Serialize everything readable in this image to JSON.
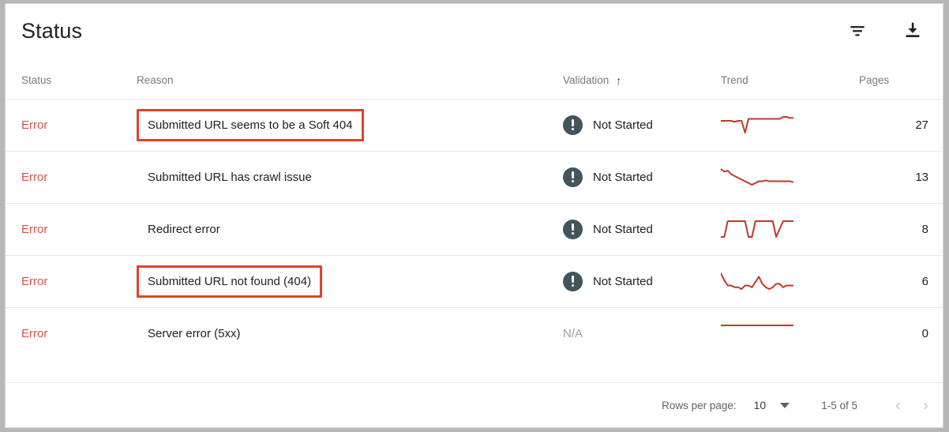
{
  "header": {
    "title": "Status",
    "filter_icon": "filter-list-icon",
    "download_icon": "download-icon"
  },
  "table": {
    "columns": [
      {
        "key": "status",
        "label": "Status"
      },
      {
        "key": "reason",
        "label": "Reason"
      },
      {
        "key": "validation",
        "label": "Validation",
        "sort": "↑",
        "sorted": true
      },
      {
        "key": "trend",
        "label": "Trend"
      },
      {
        "key": "pages",
        "label": "Pages"
      }
    ],
    "rows": [
      {
        "status": "Error",
        "reason": "Submitted URL seems to be a Soft 404",
        "highlighted": true,
        "validation": "Not Started",
        "validation_has_icon": true,
        "pages": "27",
        "trend": [
          12,
          12,
          12,
          12,
          13,
          12,
          12,
          24,
          10,
          10,
          10,
          10,
          10,
          10,
          10,
          10,
          10,
          10,
          8,
          8,
          9,
          9
        ]
      },
      {
        "status": "Error",
        "reason": "Submitted URL has crawl issue",
        "highlighted": false,
        "validation": "Not Started",
        "validation_has_icon": true,
        "pages": "13",
        "trend": [
          4,
          7,
          6,
          10,
          12,
          14,
          16,
          18,
          20,
          22,
          20,
          18,
          18,
          17,
          18,
          18,
          18,
          18,
          18,
          18,
          18,
          19
        ]
      },
      {
        "status": "Error",
        "reason": "Redirect error",
        "highlighted": false,
        "validation": "Not Started",
        "validation_has_icon": true,
        "pages": "8",
        "trend": [
          14,
          14,
          12,
          12,
          12,
          12,
          12,
          12,
          14,
          14,
          12,
          12,
          12,
          12,
          12,
          12,
          14,
          13,
          12,
          12,
          12,
          12
        ]
      },
      {
        "status": "Error",
        "reason": "Submitted URL not found (404)",
        "highlighted": true,
        "validation": "Not Started",
        "validation_has_icon": true,
        "pages": "6",
        "trend": [
          6,
          10,
          13,
          13,
          14,
          14,
          15,
          13,
          13,
          14,
          11,
          8,
          12,
          14,
          15,
          14,
          12,
          12,
          14,
          13,
          13,
          13
        ]
      },
      {
        "status": "Error",
        "reason": "Server error (5xx)",
        "highlighted": false,
        "validation": "N/A",
        "validation_has_icon": false,
        "pages": "0",
        "trend": [
          13,
          13,
          13,
          13,
          13,
          13,
          13,
          13,
          13,
          13,
          13,
          13,
          13,
          13,
          13,
          13,
          13,
          13,
          13,
          13,
          13,
          13
        ]
      }
    ]
  },
  "footer": {
    "rows_per_page_label": "Rows per page:",
    "rows_per_page_value": "10",
    "range_label": "1-5 of 5",
    "prev_icon": "chevron-left-icon",
    "next_icon": "chevron-right-icon"
  },
  "colors": {
    "error_text": "#d2544a",
    "highlight_box": "#e0442b",
    "trend_line": "#c0392b",
    "validation_icon": "#42545c",
    "muted_text": "#9aa0a6"
  },
  "chart_data": {
    "type": "line",
    "title": "Trend sparklines per error type",
    "xlabel": "",
    "ylabel": "",
    "note": "Each row's Trend column is a 22-point sparkline (y inverted: lower value = higher on screen)",
    "series": [
      {
        "name": "Submitted URL seems to be a Soft 404",
        "values": [
          12,
          12,
          12,
          12,
          13,
          12,
          12,
          24,
          10,
          10,
          10,
          10,
          10,
          10,
          10,
          10,
          10,
          10,
          8,
          8,
          9,
          9
        ]
      },
      {
        "name": "Submitted URL has crawl issue",
        "values": [
          4,
          7,
          6,
          10,
          12,
          14,
          16,
          18,
          20,
          22,
          20,
          18,
          18,
          17,
          18,
          18,
          18,
          18,
          18,
          18,
          18,
          19
        ]
      },
      {
        "name": "Redirect error",
        "values": [
          14,
          14,
          12,
          12,
          12,
          12,
          12,
          12,
          14,
          14,
          12,
          12,
          12,
          12,
          12,
          12,
          14,
          13,
          12,
          12,
          12,
          12
        ]
      },
      {
        "name": "Submitted URL not found (404)",
        "values": [
          6,
          10,
          13,
          13,
          14,
          14,
          15,
          13,
          13,
          14,
          11,
          8,
          12,
          14,
          15,
          14,
          12,
          12,
          14,
          13,
          13,
          13
        ]
      },
      {
        "name": "Server error (5xx)",
        "values": [
          13,
          13,
          13,
          13,
          13,
          13,
          13,
          13,
          13,
          13,
          13,
          13,
          13,
          13,
          13,
          13,
          13,
          13,
          13,
          13,
          13,
          13
        ]
      }
    ]
  }
}
